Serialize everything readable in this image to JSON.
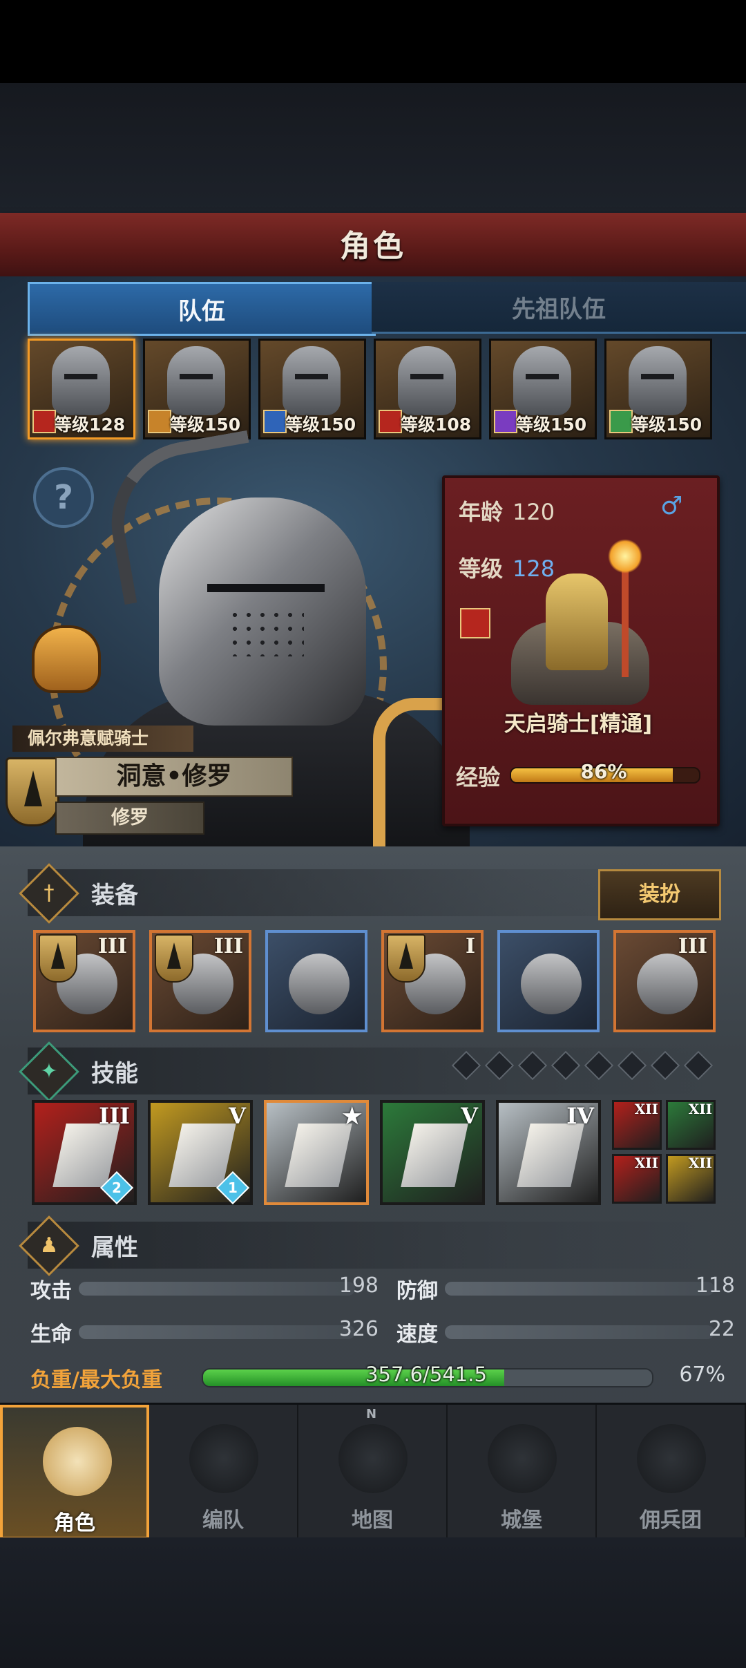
{
  "header": {
    "title": "角色"
  },
  "tabs": [
    {
      "label": "队伍",
      "active": true
    },
    {
      "label": "先祖队伍",
      "active": false
    }
  ],
  "party": [
    {
      "level_label": "等级128",
      "selected": true,
      "class_color": "#b5261e"
    },
    {
      "level_label": "等级150",
      "selected": false,
      "class_color": "#c7832a"
    },
    {
      "level_label": "等级150",
      "selected": false,
      "class_color": "#2f64b8"
    },
    {
      "level_label": "等级108",
      "selected": false,
      "class_color": "#b5261e"
    },
    {
      "level_label": "等级150",
      "selected": false,
      "class_color": "#7a3cc0"
    },
    {
      "level_label": "等级150",
      "selected": false,
      "class_color": "#3a9a4a"
    }
  ],
  "character": {
    "order": "佩尔弗意赋骑士",
    "name": "洞意•修罗",
    "subtitle": "修罗",
    "age_label": "年龄",
    "age": "120",
    "gender": "♂",
    "level_label": "等级",
    "level": "128",
    "class_name": "天启骑士[精通]",
    "exp_label": "经验",
    "exp_text": "86%",
    "exp_fraction": 0.86
  },
  "equipment": {
    "title": "装备",
    "dress_button": "装扮",
    "slots": [
      {
        "tier": "III",
        "rarity": "orange",
        "crest": true
      },
      {
        "tier": "III",
        "rarity": "orange",
        "crest": true
      },
      {
        "tier": "",
        "rarity": "blue",
        "crest": false
      },
      {
        "tier": "I",
        "rarity": "orange",
        "crest": true
      },
      {
        "tier": "",
        "rarity": "blue",
        "crest": false
      },
      {
        "tier": "III",
        "rarity": "orange",
        "crest": false
      }
    ]
  },
  "skills": {
    "title": "技能",
    "pip_count": 8,
    "items": [
      {
        "tier": "III",
        "bg": "#b3201c",
        "badge": "2"
      },
      {
        "tier": "V",
        "bg": "#c29a20",
        "badge": "1"
      },
      {
        "tier": "★",
        "bg": "#b7bfc4",
        "badge": ""
      },
      {
        "tier": "V",
        "bg": "#2c7a3a",
        "badge": ""
      },
      {
        "tier": "IV",
        "bg": "#b7bfc4",
        "badge": ""
      }
    ],
    "passives": [
      {
        "tier": "XII",
        "bg": "#b3201c"
      },
      {
        "tier": "XII",
        "bg": "#2c7a3a"
      },
      {
        "tier": "XII",
        "bg": "#b3201c"
      },
      {
        "tier": "XII",
        "bg": "#c29a20"
      }
    ]
  },
  "attributes": {
    "title": "属性",
    "attack_label": "攻击",
    "attack": "198",
    "defense_label": "防御",
    "defense": "118",
    "hp_label": "生命",
    "hp": "326",
    "speed_label": "速度",
    "speed": "22",
    "load_label": "负重/最大负重",
    "load_text": "357.6/541.5",
    "load_pct": "67%",
    "load_fraction": 0.67
  },
  "nav": [
    {
      "label": "角色",
      "active": true,
      "icon": "knight-icon"
    },
    {
      "label": "编队",
      "active": false,
      "icon": "formation-icon"
    },
    {
      "label": "地图",
      "active": false,
      "icon": "compass-icon"
    },
    {
      "label": "城堡",
      "active": false,
      "icon": "castle-icon"
    },
    {
      "label": "佣兵团",
      "active": false,
      "icon": "mercenary-icon"
    }
  ],
  "compass_north": "N"
}
